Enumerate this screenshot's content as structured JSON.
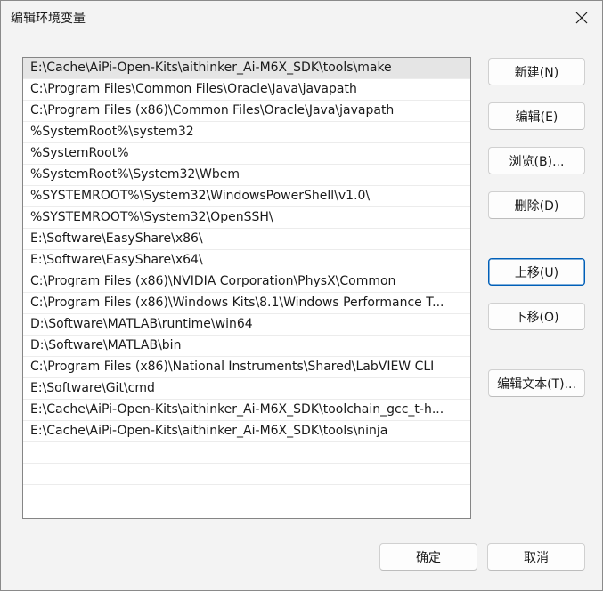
{
  "window": {
    "title": "编辑环境变量"
  },
  "paths": [
    "E:\\Cache\\AiPi-Open-Kits\\aithinker_Ai-M6X_SDK\\tools\\make",
    "C:\\Program Files\\Common Files\\Oracle\\Java\\javapath",
    "C:\\Program Files (x86)\\Common Files\\Oracle\\Java\\javapath",
    "%SystemRoot%\\system32",
    "%SystemRoot%",
    "%SystemRoot%\\System32\\Wbem",
    "%SYSTEMROOT%\\System32\\WindowsPowerShell\\v1.0\\",
    "%SYSTEMROOT%\\System32\\OpenSSH\\",
    "E:\\Software\\EasyShare\\x86\\",
    "E:\\Software\\EasyShare\\x64\\",
    "C:\\Program Files (x86)\\NVIDIA Corporation\\PhysX\\Common",
    "C:\\Program Files (x86)\\Windows Kits\\8.1\\Windows Performance T...",
    "D:\\Software\\MATLAB\\runtime\\win64",
    "D:\\Software\\MATLAB\\bin",
    "C:\\Program Files (x86)\\National Instruments\\Shared\\LabVIEW CLI",
    "E:\\Software\\Git\\cmd",
    "E:\\Cache\\AiPi-Open-Kits\\aithinker_Ai-M6X_SDK\\toolchain_gcc_t-h...",
    "E:\\Cache\\AiPi-Open-Kits\\aithinker_Ai-M6X_SDK\\tools\\ninja",
    "",
    "",
    ""
  ],
  "buttons": {
    "new": "新建(N)",
    "edit": "编辑(E)",
    "browse": "浏览(B)...",
    "delete": "删除(D)",
    "move_up": "上移(U)",
    "move_down": "下移(O)",
    "edit_text": "编辑文本(T)...",
    "ok": "确定",
    "cancel": "取消"
  }
}
